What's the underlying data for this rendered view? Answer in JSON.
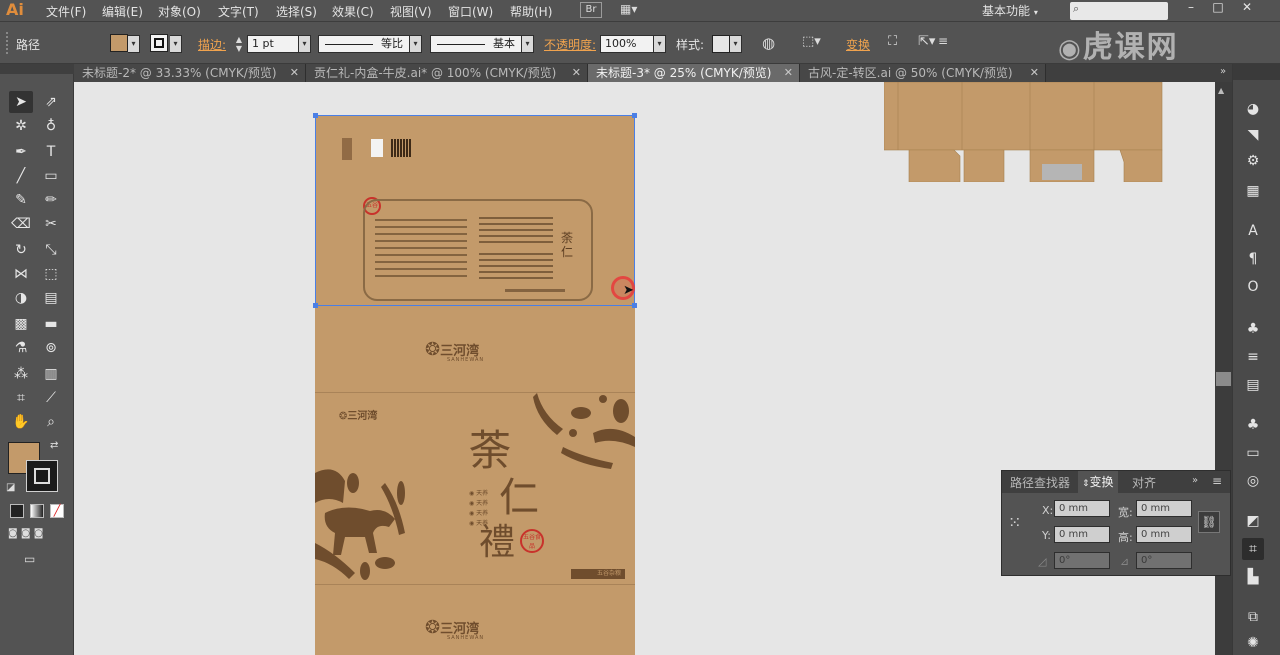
{
  "app": {
    "logo": "Ai"
  },
  "menubar": {
    "items": [
      "文件(F)",
      "编辑(E)",
      "对象(O)",
      "文字(T)",
      "选择(S)",
      "效果(C)",
      "视图(V)",
      "窗口(W)",
      "帮助(H)"
    ],
    "br_button": "Br",
    "workspace": "基本功能",
    "min": "–",
    "max": "□",
    "close": "✕"
  },
  "controlbar": {
    "mode": "路径",
    "stroke_label": "描边:",
    "stroke_value": "1 pt",
    "profile_value": "等比",
    "brush_value": "基本",
    "opacity_label": "不透明度:",
    "opacity_value": "100%",
    "style_label": "样式:",
    "transform_link": "变换"
  },
  "tabs": [
    {
      "label": "未标题-2* @ 33.33% (CMYK/预览)",
      "active": false
    },
    {
      "label": "贡仁礼-内盒-牛皮.ai* @ 100% (CMYK/预览)",
      "active": false
    },
    {
      "label": "未标题-3* @ 25% (CMYK/预览)",
      "active": true
    },
    {
      "label": "古风-定-转区.ai @ 50% (CMYK/预览)",
      "active": false
    }
  ],
  "artwork": {
    "brand": "三河湾",
    "brand_sub": "SANHEWAN",
    "title_chars": [
      "荼",
      "仁",
      "禮"
    ],
    "seal": "五谷食品",
    "bullets": [
      "天养",
      "天养",
      "天养",
      "天养"
    ],
    "footer_tag": "五谷杂粮"
  },
  "transform_panel": {
    "tabs": [
      "路径查找器",
      "变换",
      "对齐"
    ],
    "active_tab": "变换",
    "x_label": "X:",
    "x_value": "0 mm",
    "y_label": "Y:",
    "y_value": "0 mm",
    "w_label": "宽:",
    "w_value": "0 mm",
    "h_label": "高:",
    "h_value": "0 mm",
    "rotate_value": "0°",
    "shear_value": "0°"
  },
  "watermark": "虎课网",
  "colors": {
    "accent_orange": "#f0a34e",
    "kraft": "#c39a6a",
    "ink_brown": "#6f4d2d",
    "seal_red": "#c8322b",
    "selection_blue": "#4a7fe6"
  }
}
